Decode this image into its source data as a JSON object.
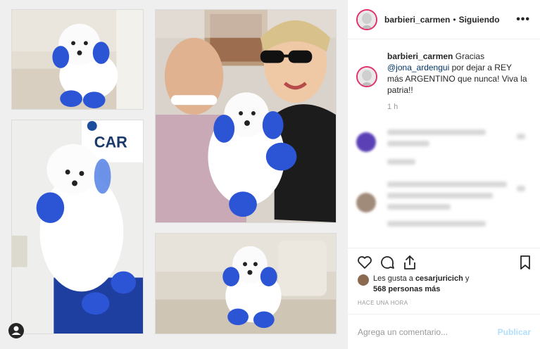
{
  "post": {
    "username": "barbieri_carmen",
    "separator": "•",
    "follow_status": "Siguiendo",
    "more_label": "•••"
  },
  "caption": {
    "username": "barbieri_carmen",
    "text_before": "Gracias",
    "mention": "@jona_ardengui",
    "text_after": "por dejar a REY más ARGENTINO que nunca! Viva la patria!!",
    "time": "1 h"
  },
  "photo_text": {
    "sign": "CAR"
  },
  "likes": {
    "prefix": "Les gusta a",
    "user": "cesarjuricich",
    "connector": "y",
    "count": "568 personas más"
  },
  "time_ago": "HACE UNA HORA",
  "comment_box": {
    "placeholder": "Agrega un comentario...",
    "publish": "Publicar"
  },
  "icons": {
    "like": "heart-icon",
    "comment": "comment-icon",
    "share": "share-icon",
    "save": "bookmark-icon",
    "more": "more-icon",
    "tag": "user-tag-icon"
  },
  "colors": {
    "story_ring": "#e1306c",
    "link": "#003569",
    "muted": "#999999",
    "publish_disabled": "#b2dffc",
    "dog_blue": "#2c55d6"
  }
}
